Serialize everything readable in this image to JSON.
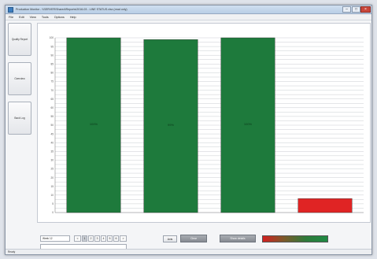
{
  "window": {
    "title": "Production Monitor - \\\\SERVER\\Shared\\Reports\\2016-03 - LINE STATUS.xlsx (read only)"
  },
  "menu": [
    "File",
    "Edit",
    "View",
    "Tools",
    "Options",
    "Help"
  ],
  "sidebar": {
    "buttons": [
      {
        "label": "Quality Report"
      },
      {
        "label": "Overview"
      },
      {
        "label": "Back Log"
      }
    ]
  },
  "chart_data": {
    "type": "bar",
    "title": "",
    "categories": [
      "",
      "",
      "",
      ""
    ],
    "values": [
      100,
      99,
      100,
      8
    ],
    "data_labels": [
      "100%",
      "99%",
      "100%",
      ""
    ],
    "colors": [
      "#1e7a3c",
      "#1e7a3c",
      "#1e7a3c",
      "#e02424"
    ],
    "ylim": [
      0,
      100
    ],
    "grid": true,
    "xlabel": "",
    "ylabel": ""
  },
  "pager": {
    "prev": "<",
    "pages": [
      "1",
      "2",
      "3",
      "4",
      "5",
      "6"
    ],
    "next": ">",
    "active": "1"
  },
  "controls": {
    "label_button": "Axis",
    "clear_button": "Clear",
    "options_button": "Show details",
    "filter_value": "Week 12"
  },
  "status": {
    "text": "Ready"
  },
  "accent": {
    "good": "#1e7a3c",
    "bad": "#e02424"
  }
}
